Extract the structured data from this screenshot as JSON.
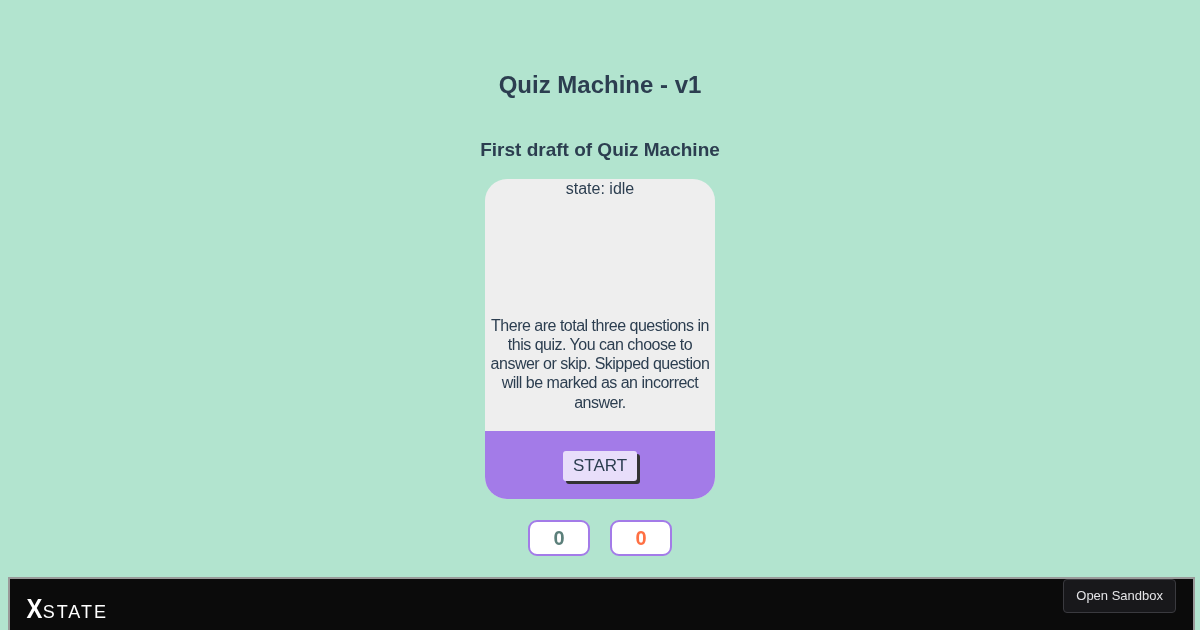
{
  "title": "Quiz Machine - v1",
  "subtitle": "First draft of Quiz Machine",
  "card": {
    "state_label": "state: idle",
    "description": "There are total three questions in this quiz. You can choose to answer or skip. Skipped question will be marked as an incorrect answer.",
    "button": "START"
  },
  "scores": [
    {
      "value": "0",
      "color": "#5b7f7a"
    },
    {
      "value": "0",
      "color": "#ff7043"
    }
  ],
  "footer": {
    "logo": {
      "mark": "X",
      "word": "STATE"
    },
    "button": "Open Sandbox"
  }
}
